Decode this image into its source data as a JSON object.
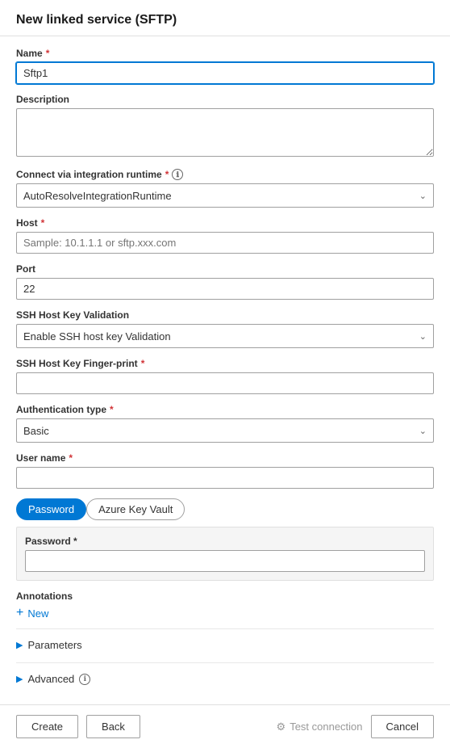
{
  "header": {
    "title": "New linked service (SFTP)"
  },
  "form": {
    "name_label": "Name",
    "name_required": "*",
    "name_value": "Sftp1",
    "description_label": "Description",
    "description_value": "",
    "description_placeholder": "",
    "connect_label": "Connect via integration runtime",
    "connect_required": "*",
    "connect_value": "AutoResolveIntegrationRuntime",
    "host_label": "Host",
    "host_required": "*",
    "host_placeholder": "Sample: 10.1.1.1 or sftp.xxx.com",
    "host_value": "",
    "port_label": "Port",
    "port_value": "22",
    "ssh_validation_label": "SSH Host Key Validation",
    "ssh_validation_value": "Enable SSH host key Validation",
    "ssh_fingerprint_label": "SSH Host Key Finger-print",
    "ssh_fingerprint_required": "*",
    "ssh_fingerprint_value": "",
    "auth_type_label": "Authentication type",
    "auth_type_required": "*",
    "auth_type_value": "Basic",
    "username_label": "User name",
    "username_required": "*",
    "username_value": "",
    "password_tab_label": "Password",
    "azure_keyvault_tab_label": "Azure Key Vault",
    "password_inner_label": "Password",
    "password_required": "*",
    "password_value": "",
    "annotations_label": "Annotations",
    "add_new_label": "New",
    "parameters_label": "Parameters",
    "advanced_label": "Advanced"
  },
  "footer": {
    "create_label": "Create",
    "back_label": "Back",
    "test_connection_label": "Test connection",
    "cancel_label": "Cancel"
  },
  "icons": {
    "info": "ℹ",
    "chevron_down": "∨",
    "arrow_right": "▶",
    "plus": "+",
    "test_icon": "⚙"
  }
}
